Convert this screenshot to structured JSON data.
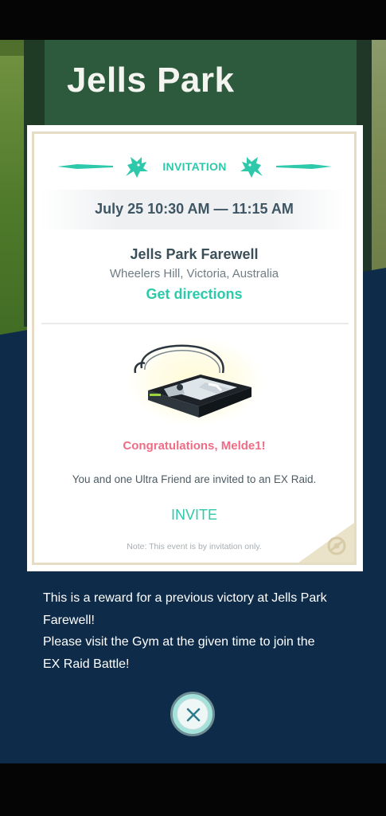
{
  "background_photo": {
    "sign_text": "Jells Park"
  },
  "invitation": {
    "header_label": "INVITATION",
    "date_time": "July 25  10:30 AM  —  11:15 AM",
    "gym_name": "Jells Park Farewell",
    "location": "Wheelers Hill, Victoria, Australia",
    "directions_label": "Get directions",
    "congratulations": "Congratulations, Melde1!",
    "description": "You and one Ultra Friend are invited to an EX Raid.",
    "invite_label": "INVITE",
    "note": "Note: This event is by invitation only."
  },
  "reward_message": {
    "line1": "This is a reward for a previous victory at Jells Park",
    "line2": "Farewell!",
    "line3": "Please visit the Gym at the given time to join the",
    "line4": "EX Raid Battle!"
  },
  "icons": {
    "dragon_left": "dragon-silhouette-icon",
    "dragon_right": "dragon-silhouette-icon",
    "pass": "ex-raid-pass-icon",
    "corner": "gym-emblem-icon",
    "close": "close-icon"
  },
  "colors": {
    "accent_teal": "#2ec9ab",
    "congrats_pink": "#ef6c85",
    "navy_background": "#0e2c49",
    "card_border": "#e4dcc5"
  }
}
